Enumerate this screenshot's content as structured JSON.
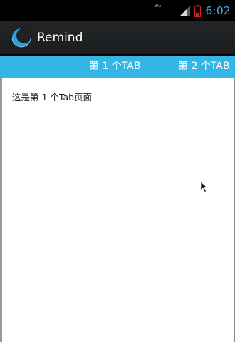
{
  "status_bar": {
    "network_type": "3G",
    "time": "6:02",
    "signal_icon": "cell-signal-icon",
    "battery_icon": "battery-low-icon"
  },
  "action_bar": {
    "title": "Remind",
    "logo_icon": "crescent-moon-logo"
  },
  "tabs": [
    {
      "label": "第 1 个TAB"
    },
    {
      "label": "第 2 个TAB"
    }
  ],
  "content": {
    "text": "这是第 1 个Tab页面"
  },
  "colors": {
    "accent": "#33b5e5",
    "action_bar_bg": "#222527",
    "status_bar_bg": "#000000",
    "content_bg": "#ffffff"
  }
}
